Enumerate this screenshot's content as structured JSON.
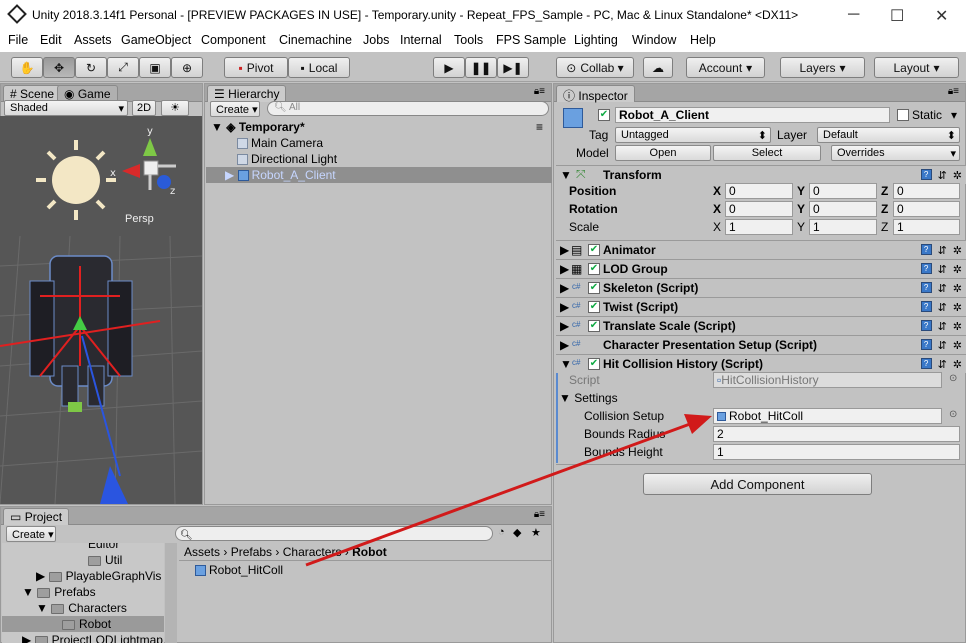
{
  "window": {
    "title": "Unity 2018.3.14f1 Personal - [PREVIEW PACKAGES IN USE] - Temporary.unity - Repeat_FPS_Sample - PC, Mac & Linux Standalone* <DX11>",
    "minimize": "─",
    "maximize": "☐",
    "close": "✕"
  },
  "menu": [
    "File",
    "Edit",
    "Assets",
    "GameObject",
    "Component",
    "Cinemachine",
    "Jobs",
    "Internal",
    "Tools",
    "FPS Sample",
    "Lighting",
    "Window",
    "Help"
  ],
  "toolbar": {
    "pivot": "Pivot",
    "local": "Local",
    "collab": "Collab ▾",
    "account": "Account",
    "layers": "Layers",
    "layout": "Layout"
  },
  "scene": {
    "tab_scene": "Scene",
    "tab_game": "Game",
    "shading": "Shaded",
    "mode2d": "2D",
    "persp": "Persp",
    "axis_x": "x",
    "axis_y": "y",
    "axis_z": "z"
  },
  "hierarchy": {
    "tab": "Hierarchy",
    "create": "Create",
    "search_placeholder": "All",
    "scene_name": "Temporary*",
    "items": [
      "Main Camera",
      "Directional Light",
      "Robot_A_Client"
    ]
  },
  "project": {
    "tab": "Project",
    "create": "Create",
    "tree": [
      "Editor",
      "Util",
      "PlayableGraphVis",
      "Prefabs",
      "Characters",
      "Robot",
      "ProjectLODLightmap"
    ],
    "breadcrumb": [
      "Assets",
      "Prefabs",
      "Characters",
      "Robot"
    ],
    "asset": "Robot_HitColl"
  },
  "inspector": {
    "tab": "Inspector",
    "object_name": "Robot_A_Client",
    "static_label": "Static",
    "tag_label": "Tag",
    "tag_value": "Untagged",
    "layer_label": "Layer",
    "layer_value": "Default",
    "model_label": "Model",
    "open": "Open",
    "select": "Select",
    "overrides": "Overrides",
    "transform": {
      "title": "Transform",
      "position": "Position",
      "rotation": "Rotation",
      "scale": "Scale",
      "pos": [
        "0",
        "0",
        "0"
      ],
      "rot": [
        "0",
        "0",
        "0"
      ],
      "scl": [
        "1",
        "1",
        "1"
      ],
      "x": "X",
      "y": "Y",
      "z": "Z"
    },
    "components": [
      "Animator",
      "LOD Group",
      "Skeleton (Script)",
      "Twist (Script)",
      "Translate Scale (Script)",
      "Character Presentation Setup (Script)",
      "Hit Collision History (Script)"
    ],
    "script_label": "Script",
    "script_value": "HitCollisionHistory",
    "settings_label": "Settings",
    "collision_setup_label": "Collision Setup",
    "collision_setup_value": "Robot_HitColl",
    "bounds_radius_label": "Bounds Radius",
    "bounds_radius_value": "2",
    "bounds_height_label": "Bounds Height",
    "bounds_height_value": "1",
    "add_component": "Add Component"
  },
  "colors": {
    "arrow": "#d11a1a",
    "selection": "#8fa7d6",
    "accent": "#3a78c8"
  }
}
